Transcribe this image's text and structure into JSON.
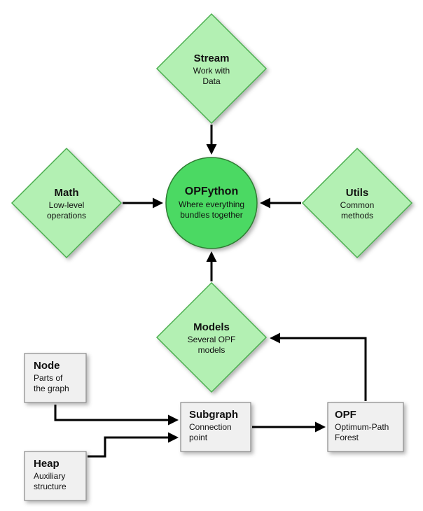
{
  "center": {
    "title": "OPFython",
    "subtitle1": "Where everything",
    "subtitle2": "bundles together"
  },
  "diamonds": {
    "stream": {
      "title": "Stream",
      "sub1": "Work with",
      "sub2": "Data"
    },
    "math": {
      "title": "Math",
      "sub1": "Low-level",
      "sub2": "operations"
    },
    "utils": {
      "title": "Utils",
      "sub1": "Common",
      "sub2": "methods"
    },
    "models": {
      "title": "Models",
      "sub1": "Several OPF",
      "sub2": "models"
    }
  },
  "boxes": {
    "node": {
      "title": "Node",
      "sub1": "Parts of",
      "sub2": "the graph"
    },
    "heap": {
      "title": "Heap",
      "sub1": "Auxiliary",
      "sub2": "structure"
    },
    "subgraph": {
      "title": "Subgraph",
      "sub1": "Connection",
      "sub2": "point"
    },
    "opf": {
      "title": "OPF",
      "sub1": "Optimum-Path",
      "sub2": "Forest"
    }
  },
  "colors": {
    "diamondFill": "#b3f0b3",
    "diamondStroke": "#4caf50",
    "circleFill": "#4cd964",
    "circleStroke": "#2e7d32",
    "boxFill": "#f0f0f0",
    "boxStroke": "#888888",
    "arrow": "#000000",
    "text": "#222222",
    "shadow": "rgba(0,0,0,0.25)"
  }
}
